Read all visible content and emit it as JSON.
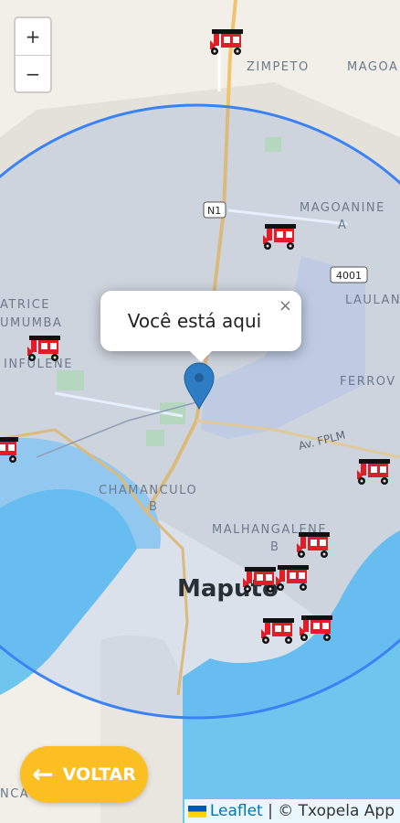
{
  "map": {
    "city_label": "Maputo",
    "place_labels": [
      "ZIMPETO",
      "MAGOA",
      "MAGOANINE",
      "A",
      "LAULAN",
      "ATRICE",
      "UMUMBA",
      "INFULENE",
      "FERROV",
      "CHAMANCULO",
      "B",
      "MALHANGALENE",
      "B",
      "NCA"
    ],
    "road_labels": [
      "N1",
      "4001",
      "Av. FPLM"
    ]
  },
  "zoom": {
    "in_label": "+",
    "out_label": "−"
  },
  "popup": {
    "text": "Você está aqui",
    "close_label": "×"
  },
  "back_button": {
    "label": "VOLTAR",
    "arrow": "←"
  },
  "attribution": {
    "leaflet": "Leaflet",
    "separator": " | ",
    "credit": "© Txopela App"
  },
  "colors": {
    "accent": "#fbbf24",
    "circle": "#3b82f6",
    "marker": "#2e7cc4",
    "vehicle": "#e11d2a"
  },
  "vehicles": [
    "tuk-tuk",
    "tuk-tuk",
    "tuk-tuk",
    "tuk-tuk",
    "tuk-tuk",
    "tuk-tuk",
    "tuk-tuk",
    "tuk-tuk",
    "tuk-tuk",
    "tuk-tuk"
  ]
}
